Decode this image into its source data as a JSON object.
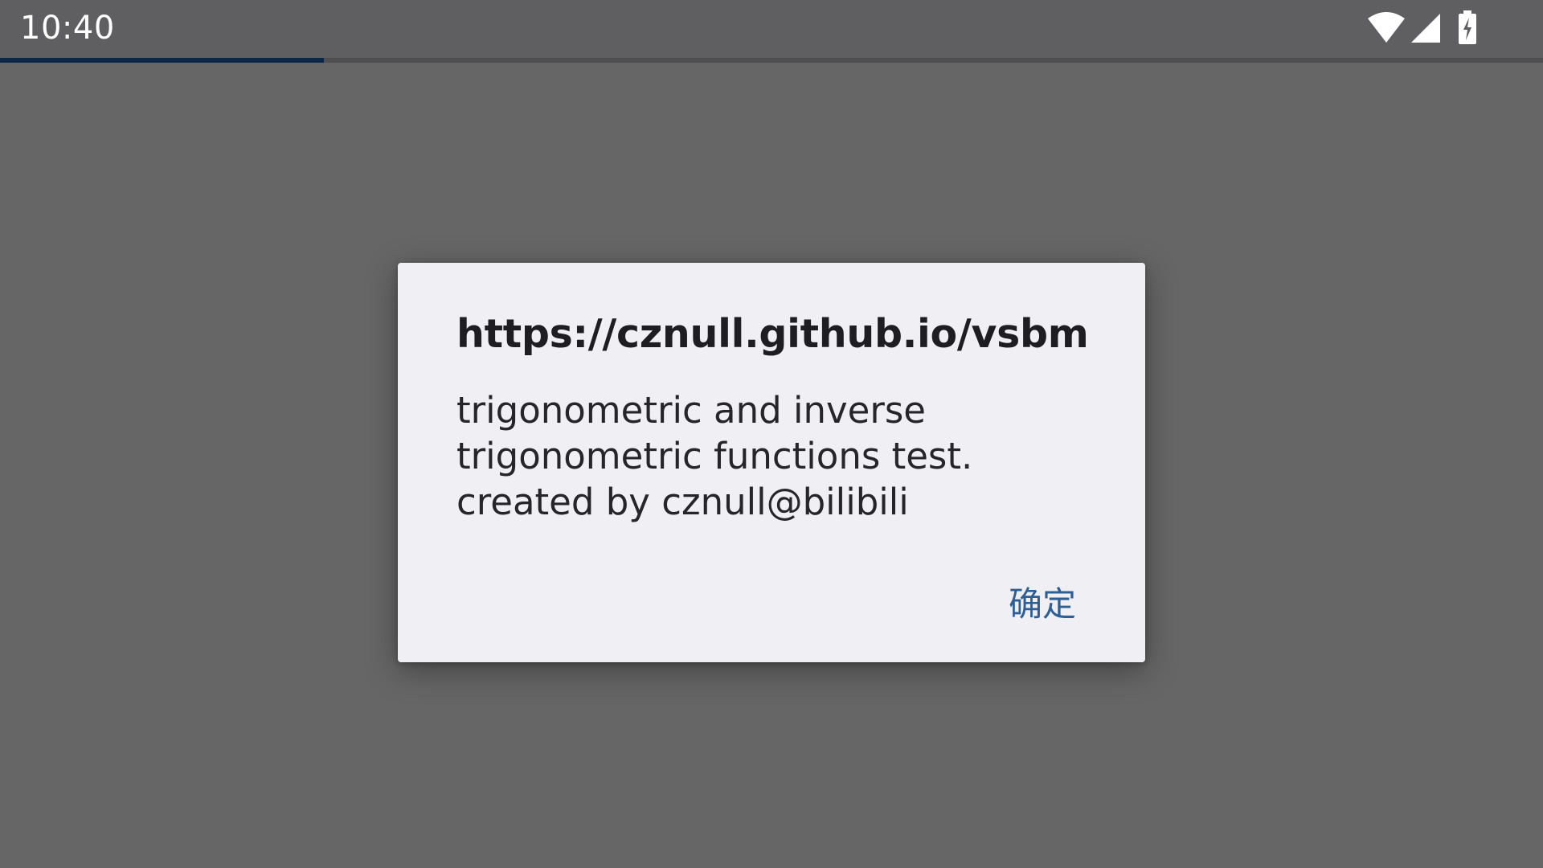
{
  "status_bar": {
    "time": "10:40",
    "icons": [
      "wifi-icon",
      "cellular-signal-icon",
      "battery-charging-icon"
    ]
  },
  "loading": {
    "progress_percent": 21
  },
  "dialog": {
    "title": "https://cznull.github.io/vsbm",
    "message": "trigonometric and inverse\ntrigonometric functions test.\ncreated by cznull@bilibili",
    "ok_label": "确定"
  },
  "colors": {
    "background": "#666666",
    "status_bar": "#5f5f61",
    "dialog": "#f0f0f4",
    "accent": "#2e5f94",
    "progress": "#0f2746"
  }
}
